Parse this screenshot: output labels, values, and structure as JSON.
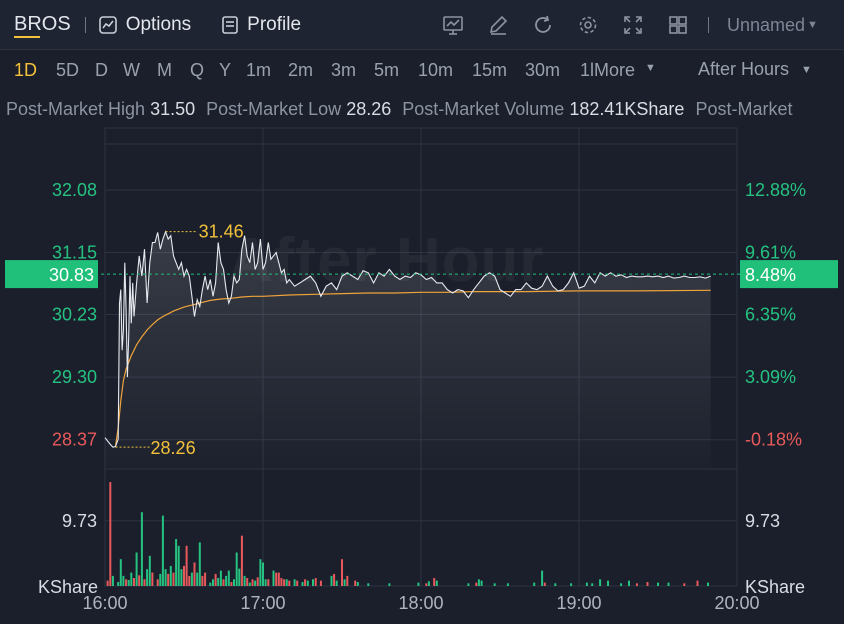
{
  "toolbar": {
    "ticker": "BROS",
    "options_label": "Options",
    "profile_label": "Profile",
    "icons": [
      "indicator-chart-icon",
      "draw-pen-icon",
      "refresh-icon",
      "settings-gear-icon",
      "fullscreen-icon",
      "layout-grid-icon"
    ],
    "layout_name": "Unnamed"
  },
  "periods": [
    "1D",
    "5D",
    "D",
    "W",
    "M",
    "Q",
    "Y",
    "1m",
    "2m",
    "3m",
    "5m",
    "10m",
    "15m",
    "30m",
    "1lMore"
  ],
  "active_period": "1D",
  "session": "After Hours",
  "stats": {
    "high_label": "Post-Market High",
    "high_value": "31.50",
    "low_label": "Post-Market Low",
    "low_value": "28.26",
    "volume_label": "Post-Market Volume",
    "volume_value": "182.41KShare",
    "extra_label": "Post-Market"
  },
  "watermark": "After Hour",
  "colors": {
    "up": "#26c281",
    "down": "#e8595b",
    "price_line": "#e6e9ee",
    "avg_line": "#f0a33a",
    "annotation": "#f3c13a",
    "current_tag": "#21c07a"
  },
  "chart_data": {
    "type": "line",
    "x_axis": {
      "ticks": [
        "16:00",
        "17:00",
        "18:00",
        "19:00",
        "20:00"
      ],
      "range_minutes": [
        0,
        240
      ]
    },
    "y_left_ticks": [
      "32.08",
      "31.15",
      "30.23",
      "29.30",
      "28.37"
    ],
    "y_left_tick_values": [
      32.08,
      31.15,
      30.23,
      29.3,
      28.37
    ],
    "y_right_ticks": [
      "12.88%",
      "9.61%",
      "6.35%",
      "3.09%",
      "-0.18%"
    ],
    "ylim": [
      27.95,
      33.0
    ],
    "current_price": "30.83",
    "current_pct": "8.48%",
    "current_value": 30.83,
    "high_label": "31.46",
    "high_point": [
      23,
      31.46
    ],
    "low_label": "28.26",
    "low_point": [
      4,
      28.26
    ],
    "price_series": [
      [
        0,
        28.4
      ],
      [
        2,
        28.3
      ],
      [
        3,
        28.26
      ],
      [
        4,
        28.27
      ],
      [
        5,
        28.38
      ],
      [
        5.5,
        30.4
      ],
      [
        6,
        30.6
      ],
      [
        6.5,
        29.7
      ],
      [
        7,
        30.0
      ],
      [
        7.5,
        31.0
      ],
      [
        8,
        30.3
      ],
      [
        8.5,
        29.3
      ],
      [
        9,
        29.9
      ],
      [
        9.5,
        30.8
      ],
      [
        10,
        30.1
      ],
      [
        10.5,
        30.7
      ],
      [
        11,
        30.2
      ],
      [
        12,
        30.7
      ],
      [
        13,
        31.1
      ],
      [
        14,
        30.8
      ],
      [
        15,
        31.2
      ],
      [
        16,
        30.4
      ],
      [
        17,
        31.0
      ],
      [
        18,
        31.3
      ],
      [
        19,
        31.3
      ],
      [
        20,
        31.45
      ],
      [
        21,
        31.2
      ],
      [
        22,
        31.35
      ],
      [
        23,
        31.46
      ],
      [
        24,
        31.35
      ],
      [
        25,
        31.4
      ],
      [
        26,
        31.1
      ],
      [
        27,
        31.0
      ],
      [
        28,
        30.9
      ],
      [
        29,
        31.0
      ],
      [
        30,
        30.8
      ],
      [
        31,
        30.9
      ],
      [
        32,
        30.8
      ],
      [
        33,
        30.5
      ],
      [
        34,
        30.2
      ],
      [
        35,
        30.45
      ],
      [
        36,
        30.35
      ],
      [
        37,
        30.6
      ],
      [
        38,
        30.8
      ],
      [
        39,
        30.6
      ],
      [
        40,
        30.75
      ],
      [
        41,
        30.5
      ],
      [
        42,
        30.7
      ],
      [
        43,
        31.3
      ],
      [
        44,
        31.0
      ],
      [
        45,
        30.9
      ],
      [
        46,
        30.6
      ],
      [
        47,
        30.4
      ],
      [
        48,
        30.5
      ],
      [
        49,
        30.8
      ],
      [
        50,
        30.7
      ],
      [
        51,
        30.75
      ],
      [
        52,
        31.2
      ],
      [
        53,
        31.4
      ],
      [
        54,
        31.1
      ],
      [
        55,
        31.0
      ],
      [
        56,
        31.3
      ],
      [
        57,
        30.9
      ],
      [
        58,
        31.0
      ],
      [
        59,
        31.35
      ],
      [
        60,
        30.9
      ],
      [
        61,
        31.0
      ],
      [
        62,
        31.3
      ],
      [
        63,
        31.05
      ],
      [
        64,
        31.1
      ],
      [
        65,
        31.15
      ],
      [
        66,
        31.0
      ],
      [
        67,
        30.85
      ],
      [
        68,
        30.9
      ],
      [
        69,
        30.7
      ],
      [
        70,
        30.75
      ],
      [
        72,
        30.65
      ],
      [
        74,
        30.7
      ],
      [
        76,
        30.75
      ],
      [
        78,
        30.8
      ],
      [
        80,
        30.7
      ],
      [
        82,
        30.5
      ],
      [
        84,
        30.65
      ],
      [
        86,
        30.7
      ],
      [
        88,
        30.6
      ],
      [
        90,
        30.8
      ],
      [
        92,
        30.85
      ],
      [
        94,
        30.8
      ],
      [
        96,
        30.75
      ],
      [
        98,
        30.88
      ],
      [
        100,
        30.85
      ],
      [
        102,
        30.7
      ],
      [
        104,
        30.85
      ],
      [
        106,
        30.8
      ],
      [
        108,
        30.9
      ],
      [
        110,
        30.8
      ],
      [
        112,
        30.75
      ],
      [
        114,
        30.8
      ],
      [
        116,
        30.78
      ],
      [
        118,
        30.85
      ],
      [
        120,
        30.82
      ],
      [
        122,
        30.75
      ],
      [
        124,
        30.78
      ],
      [
        126,
        30.7
      ],
      [
        128,
        30.7
      ],
      [
        130,
        30.6
      ],
      [
        132,
        30.55
      ],
      [
        134,
        30.6
      ],
      [
        136,
        30.58
      ],
      [
        138,
        30.48
      ],
      [
        140,
        30.6
      ],
      [
        142,
        30.7
      ],
      [
        144,
        30.8
      ],
      [
        146,
        30.85
      ],
      [
        148,
        30.8
      ],
      [
        150,
        30.6
      ],
      [
        152,
        30.55
      ],
      [
        154,
        30.5
      ],
      [
        156,
        30.6
      ],
      [
        158,
        30.6
      ],
      [
        160,
        30.7
      ],
      [
        162,
        30.62
      ],
      [
        164,
        30.6
      ],
      [
        166,
        30.65
      ],
      [
        168,
        30.8
      ],
      [
        170,
        30.65
      ],
      [
        172,
        30.58
      ],
      [
        174,
        30.6
      ],
      [
        176,
        30.7
      ],
      [
        178,
        30.85
      ],
      [
        180,
        30.62
      ],
      [
        182,
        30.65
      ],
      [
        184,
        30.8
      ],
      [
        186,
        30.7
      ],
      [
        188,
        30.85
      ],
      [
        190,
        30.8
      ],
      [
        192,
        30.85
      ],
      [
        194,
        30.8
      ],
      [
        196,
        30.82
      ],
      [
        198,
        30.78
      ],
      [
        200,
        30.8
      ],
      [
        202,
        30.79
      ],
      [
        204,
        30.79
      ],
      [
        206,
        30.8
      ],
      [
        208,
        30.79
      ],
      [
        210,
        30.8
      ],
      [
        212,
        30.78
      ],
      [
        214,
        30.8
      ],
      [
        216,
        30.77
      ],
      [
        218,
        30.78
      ],
      [
        220,
        30.8
      ],
      [
        222,
        30.78
      ],
      [
        224,
        30.78
      ],
      [
        226,
        30.79
      ],
      [
        228,
        30.77
      ],
      [
        230,
        30.8
      ]
    ],
    "average_series": [
      [
        4,
        28.27
      ],
      [
        5,
        28.55
      ],
      [
        6,
        28.95
      ],
      [
        7,
        29.25
      ],
      [
        8,
        29.42
      ],
      [
        9,
        29.52
      ],
      [
        10,
        29.62
      ],
      [
        11,
        29.7
      ],
      [
        12,
        29.78
      ],
      [
        14,
        29.9
      ],
      [
        16,
        30.0
      ],
      [
        18,
        30.08
      ],
      [
        20,
        30.15
      ],
      [
        22,
        30.2
      ],
      [
        24,
        30.24
      ],
      [
        26,
        30.28
      ],
      [
        28,
        30.31
      ],
      [
        30,
        30.34
      ],
      [
        32,
        30.36
      ],
      [
        34,
        30.38
      ],
      [
        36,
        30.4
      ],
      [
        38,
        30.42
      ],
      [
        40,
        30.44
      ],
      [
        44,
        30.46
      ],
      [
        48,
        30.47
      ],
      [
        52,
        30.49
      ],
      [
        56,
        30.5
      ],
      [
        60,
        30.5
      ],
      [
        70,
        30.52
      ],
      [
        80,
        30.53
      ],
      [
        90,
        30.54
      ],
      [
        100,
        30.55
      ],
      [
        110,
        30.55
      ],
      [
        120,
        30.56
      ],
      [
        130,
        30.56
      ],
      [
        140,
        30.57
      ],
      [
        160,
        30.57
      ],
      [
        180,
        30.58
      ],
      [
        200,
        30.58
      ],
      [
        230,
        30.59
      ]
    ],
    "volume": {
      "unit_label": "KShare",
      "tick_label": "9.73",
      "tick_value": 9.73,
      "ylim": [
        0,
        17.3
      ],
      "bars": [
        [
          1,
          0.8,
          "down"
        ],
        [
          2,
          15.5,
          "down"
        ],
        [
          3,
          1.5,
          "up"
        ],
        [
          5,
          0.6,
          "up"
        ],
        [
          6,
          4.0,
          "up"
        ],
        [
          7,
          1.5,
          "up"
        ],
        [
          8,
          1.0,
          "down"
        ],
        [
          9,
          0.9,
          "up"
        ],
        [
          10,
          2.0,
          "up"
        ],
        [
          11,
          1.2,
          "down"
        ],
        [
          12,
          5.0,
          "up"
        ],
        [
          13,
          1.6,
          "down"
        ],
        [
          14,
          11.0,
          "up"
        ],
        [
          15,
          1.0,
          "down"
        ],
        [
          16,
          2.5,
          "up"
        ],
        [
          17,
          4.5,
          "up"
        ],
        [
          18,
          2.0,
          "down"
        ],
        [
          20,
          1.0,
          "down"
        ],
        [
          21,
          1.8,
          "up"
        ],
        [
          22,
          10.5,
          "up"
        ],
        [
          23,
          2.5,
          "up"
        ],
        [
          24,
          1.8,
          "down"
        ],
        [
          25,
          3.0,
          "up"
        ],
        [
          26,
          2.0,
          "down"
        ],
        [
          27,
          7.0,
          "up"
        ],
        [
          28,
          6.0,
          "up"
        ],
        [
          29,
          2.5,
          "up"
        ],
        [
          30,
          3.0,
          "down"
        ],
        [
          31,
          6.0,
          "down"
        ],
        [
          32,
          1.5,
          "down"
        ],
        [
          33,
          2.0,
          "up"
        ],
        [
          34,
          3.5,
          "down"
        ],
        [
          35,
          2.0,
          "up"
        ],
        [
          36,
          6.5,
          "up"
        ],
        [
          37,
          1.5,
          "down"
        ],
        [
          38,
          2.0,
          "down"
        ],
        [
          40,
          0.5,
          "up"
        ],
        [
          41,
          1.0,
          "up"
        ],
        [
          42,
          1.8,
          "down"
        ],
        [
          43,
          1.2,
          "up"
        ],
        [
          44,
          2.3,
          "up"
        ],
        [
          45,
          1.0,
          "down"
        ],
        [
          46,
          1.5,
          "up"
        ],
        [
          47,
          2.3,
          "up"
        ],
        [
          48,
          0.6,
          "down"
        ],
        [
          49,
          1.0,
          "up"
        ],
        [
          50,
          5.0,
          "up"
        ],
        [
          51,
          2.6,
          "up"
        ],
        [
          52,
          7.5,
          "down"
        ],
        [
          53,
          1.5,
          "up"
        ],
        [
          54,
          1.2,
          "down"
        ],
        [
          55,
          0.5,
          "up"
        ],
        [
          56,
          1.0,
          "down"
        ],
        [
          57,
          0.8,
          "up"
        ],
        [
          58,
          1.3,
          "down"
        ],
        [
          59,
          4.0,
          "up"
        ],
        [
          60,
          3.5,
          "up"
        ],
        [
          61,
          1.0,
          "up"
        ],
        [
          62,
          1.0,
          "down"
        ],
        [
          64,
          2.3,
          "up"
        ],
        [
          65,
          2.0,
          "down"
        ],
        [
          66,
          2.0,
          "down"
        ],
        [
          67,
          1.2,
          "down"
        ],
        [
          68,
          1.0,
          "down"
        ],
        [
          69,
          1.0,
          "up"
        ],
        [
          70,
          0.8,
          "down"
        ],
        [
          72,
          1.0,
          "up"
        ],
        [
          73,
          0.8,
          "down"
        ],
        [
          75,
          0.6,
          "up"
        ],
        [
          76,
          1.0,
          "down"
        ],
        [
          77,
          0.8,
          "up"
        ],
        [
          79,
          1.0,
          "up"
        ],
        [
          80,
          1.2,
          "down"
        ],
        [
          82,
          0.8,
          "down"
        ],
        [
          86,
          1.5,
          "up"
        ],
        [
          87,
          1.8,
          "down"
        ],
        [
          88,
          0.8,
          "up"
        ],
        [
          90,
          4.0,
          "down"
        ],
        [
          91,
          1.0,
          "up"
        ],
        [
          92,
          1.5,
          "down"
        ],
        [
          95,
          0.8,
          "down"
        ],
        [
          96,
          0.6,
          "up"
        ],
        [
          100,
          0.4,
          "up"
        ],
        [
          108,
          0.4,
          "up"
        ],
        [
          119,
          0.5,
          "up"
        ],
        [
          122,
          0.4,
          "down"
        ],
        [
          123,
          0.7,
          "up"
        ],
        [
          125,
          1.2,
          "down"
        ],
        [
          126,
          0.8,
          "up"
        ],
        [
          138,
          0.4,
          "up"
        ],
        [
          141,
          0.5,
          "down"
        ],
        [
          142,
          1.0,
          "up"
        ],
        [
          143,
          0.8,
          "up"
        ],
        [
          148,
          0.4,
          "up"
        ],
        [
          153,
          0.4,
          "up"
        ],
        [
          163,
          0.5,
          "up"
        ],
        [
          166,
          2.3,
          "up"
        ],
        [
          167,
          0.5,
          "down"
        ],
        [
          171,
          0.4,
          "up"
        ],
        [
          177,
          0.4,
          "up"
        ],
        [
          183,
          0.5,
          "up"
        ],
        [
          185,
          0.4,
          "up"
        ],
        [
          188,
          1.0,
          "up"
        ],
        [
          191,
          0.8,
          "up"
        ],
        [
          196,
          0.4,
          "up"
        ],
        [
          199,
          0.8,
          "up"
        ],
        [
          202,
          0.4,
          "down"
        ],
        [
          206,
          0.6,
          "down"
        ],
        [
          210,
          0.5,
          "up"
        ],
        [
          214,
          0.5,
          "up"
        ],
        [
          220,
          0.4,
          "down"
        ],
        [
          225,
          0.8,
          "down"
        ],
        [
          229,
          0.5,
          "up"
        ]
      ]
    }
  }
}
